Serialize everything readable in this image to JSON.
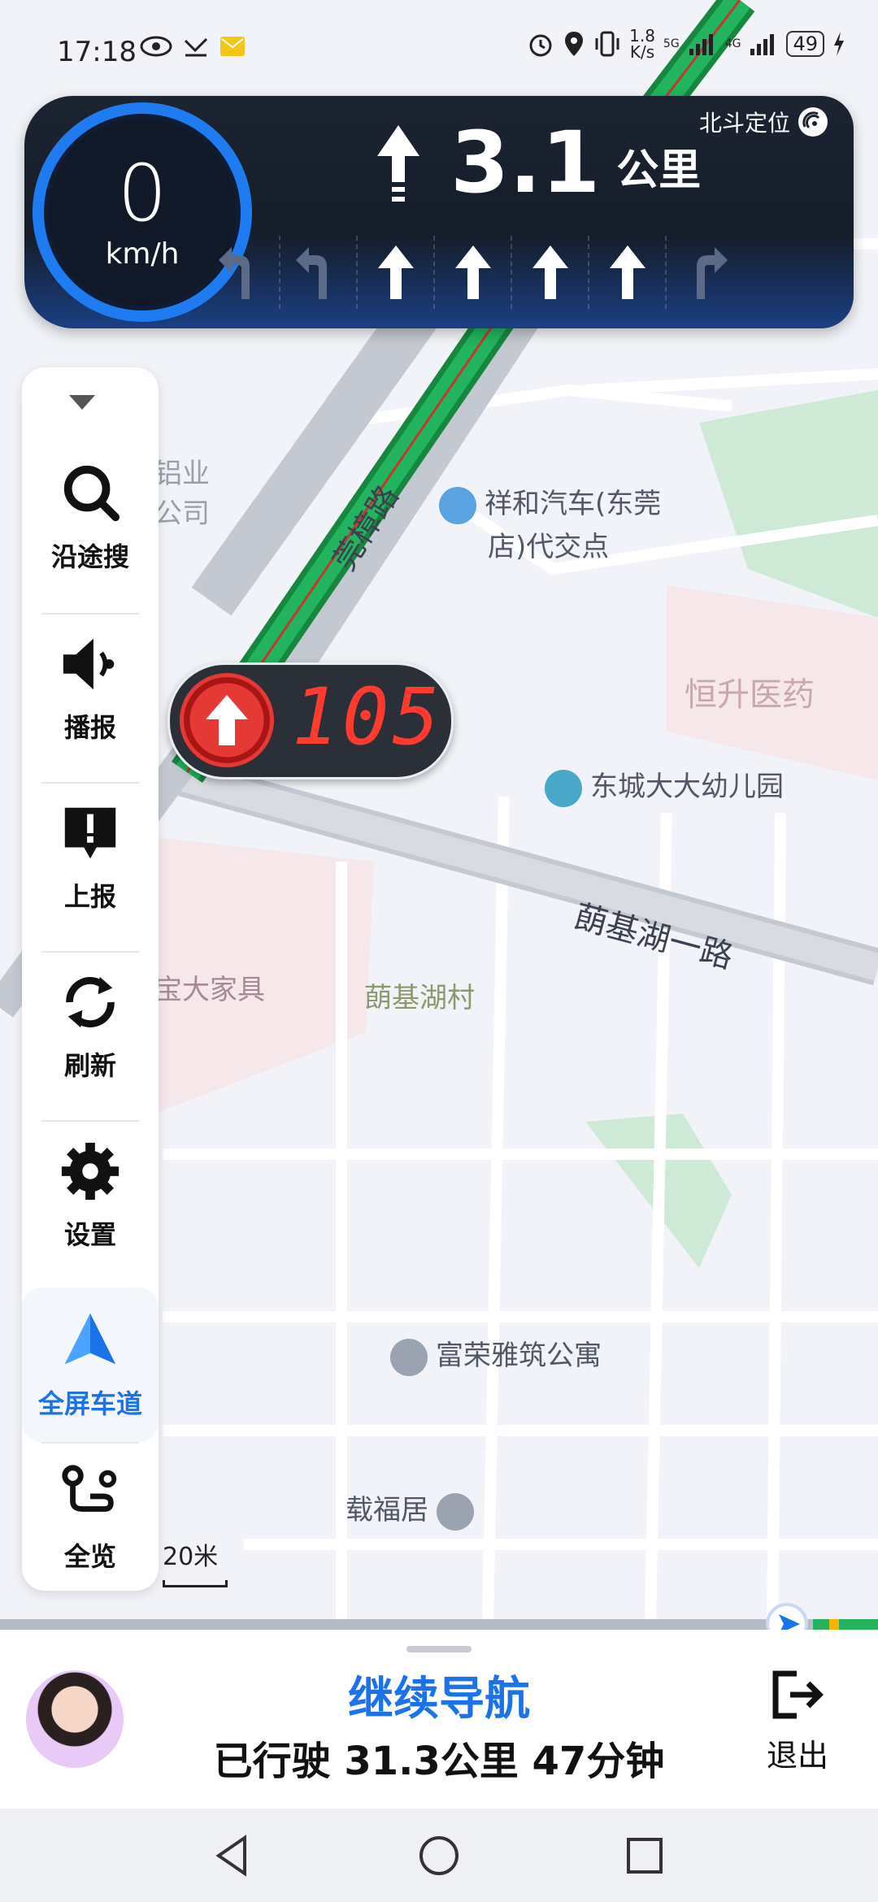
{
  "status_bar": {
    "time": "17:18",
    "net_speed": "1.8",
    "net_speed_unit": "K/s",
    "signal1": "5G",
    "signal2": "4G",
    "battery": "49"
  },
  "nav": {
    "speed": "0",
    "speed_unit": "km/h",
    "distance": "3.1",
    "distance_unit": "公里",
    "positioning": "北斗定位",
    "lanes": [
      "turn-left-uturn",
      "turn-left-uturn",
      "straight-highlight",
      "straight-highlight",
      "straight-highlight",
      "straight-highlight",
      "turn-right"
    ]
  },
  "speed_camera": {
    "limit": "105"
  },
  "toolbar": {
    "search_along": "沿途搜",
    "broadcast": "播报",
    "report": "上报",
    "refresh": "刷新",
    "settings": "设置",
    "fullscreen_lane": "全屏车道",
    "overview": "全览"
  },
  "map": {
    "scale": "20米",
    "road_main": "莞樟路",
    "road_cross": "蓢基湖一路",
    "pois": {
      "p1": "祥和汽车(东莞",
      "p1b": "店)代交点",
      "p2": "恒升医药",
      "p3": "东城大大幼儿园",
      "p4": "蓢基湖村",
      "p5": "富荣雅筑公寓",
      "p6": "载福居",
      "p7": "宝大家具",
      "p8a": "铝业",
      "p8b": "公司"
    }
  },
  "bottom": {
    "continue": "继续导航",
    "trip": "已行驶 31.3公里 47分钟",
    "exit": "退出"
  },
  "colors": {
    "accent": "#1a73e8",
    "route": "#1fa85a",
    "camera": "#e53935"
  }
}
